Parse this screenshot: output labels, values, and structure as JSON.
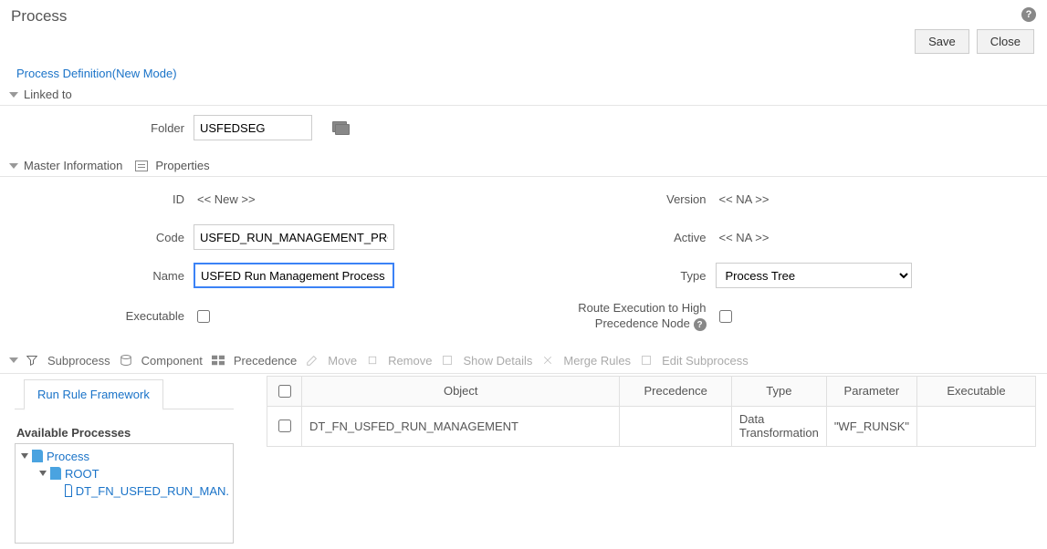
{
  "page_title": "Process",
  "buttons": {
    "save": "Save",
    "close": "Close"
  },
  "breadcrumb_link": "Process Definition(New Mode)",
  "sections": {
    "linked_to": "Linked to",
    "master_info": "Master Information",
    "properties_label": "Properties"
  },
  "linked": {
    "folder_label": "Folder",
    "folder_value": "USFEDSEG"
  },
  "master": {
    "id_label": "ID",
    "id_value": "<< New >>",
    "code_label": "Code",
    "code_value": "USFED_RUN_MANAGEMENT_PROCESS",
    "name_label": "Name",
    "name_value": "USFED Run Management Process",
    "executable_label": "Executable",
    "version_label": "Version",
    "version_value": "<< NA >>",
    "active_label": "Active",
    "active_value": "<< NA >>",
    "type_label": "Type",
    "type_value": "Process Tree",
    "route_label": "Route Execution to High Precedence Node"
  },
  "toolbar": {
    "subprocess": "Subprocess",
    "component": "Component",
    "precedence": "Precedence",
    "move": "Move",
    "remove": "Remove",
    "show_details": "Show Details",
    "merge_rules": "Merge Rules",
    "edit_subprocess": "Edit Subprocess"
  },
  "tab_label": "Run Rule Framework",
  "tree": {
    "heading": "Available Processes",
    "root": "Process",
    "level1": "ROOT",
    "level2": "DT_FN_USFED_RUN_MAN."
  },
  "grid": {
    "headers": {
      "object": "Object",
      "precedence": "Precedence",
      "type": "Type",
      "parameter": "Parameter",
      "executable": "Executable"
    },
    "rows": [
      {
        "object": "DT_FN_USFED_RUN_MANAGEMENT",
        "precedence": "",
        "type": "Data Transformation",
        "parameter": "\"WF_RUNSK\"",
        "executable": ""
      }
    ]
  }
}
